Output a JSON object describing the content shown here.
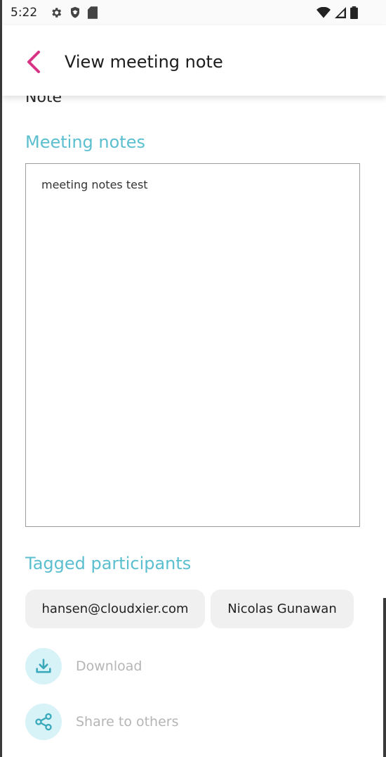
{
  "status_bar": {
    "time": "5:22",
    "left_icons": [
      "settings-icon",
      "shield-icon",
      "sd-card-icon"
    ],
    "right_icons": [
      "wifi-icon",
      "signal-icon",
      "battery-icon"
    ]
  },
  "app_bar": {
    "title": "View meeting note",
    "back_icon": "chevron-left-icon"
  },
  "partial_label": "Note",
  "meeting_notes": {
    "heading": "Meeting notes",
    "content": "meeting notes test"
  },
  "participants": {
    "heading": "Tagged participants",
    "items": [
      {
        "label": "hansen@cloudxier.com"
      },
      {
        "label": "Nicolas Gunawan"
      }
    ]
  },
  "actions": {
    "download": {
      "label": "Download",
      "icon": "download-icon"
    },
    "share": {
      "label": "Share to others",
      "icon": "share-icon"
    }
  },
  "colors": {
    "accent": "#5bbfcf",
    "back_arrow": "#d63384",
    "chip_bg": "#f0f0f0",
    "action_circle_bg": "#d8f3f7",
    "action_label": "#b5b5b5"
  }
}
